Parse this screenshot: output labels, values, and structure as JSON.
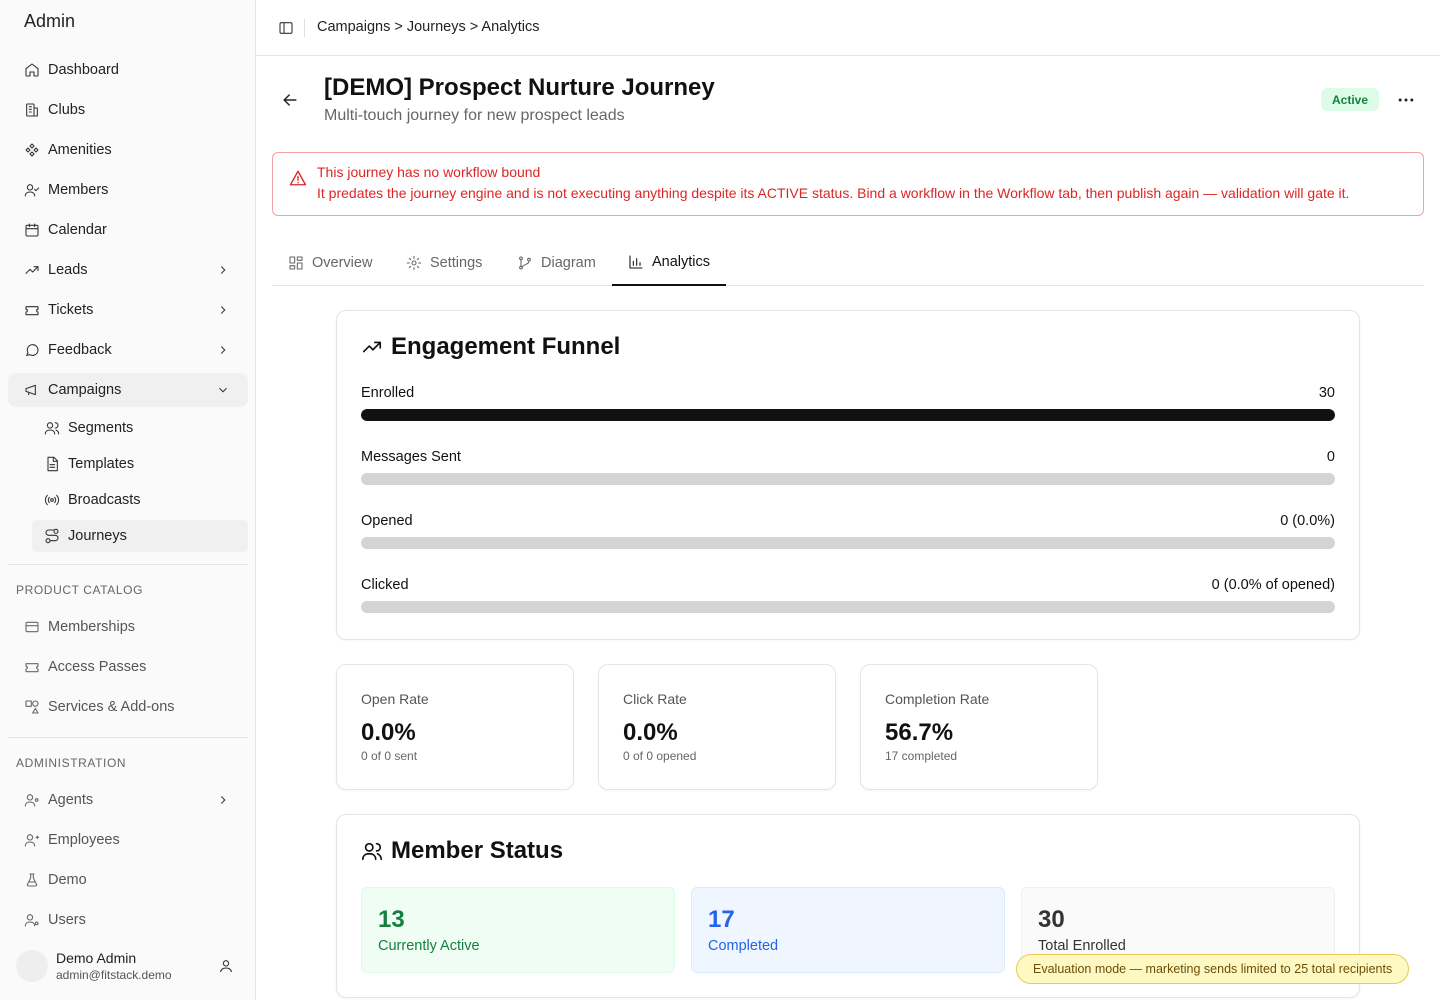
{
  "sidebar": {
    "brand": "Admin",
    "items": [
      {
        "label": "Dashboard"
      },
      {
        "label": "Clubs"
      },
      {
        "label": "Amenities"
      },
      {
        "label": "Members"
      },
      {
        "label": "Calendar"
      },
      {
        "label": "Leads"
      },
      {
        "label": "Tickets"
      },
      {
        "label": "Feedback"
      },
      {
        "label": "Campaigns"
      }
    ],
    "campaign_sub": [
      {
        "label": "Segments"
      },
      {
        "label": "Templates"
      },
      {
        "label": "Broadcasts"
      },
      {
        "label": "Journeys"
      }
    ],
    "product_catalog": {
      "heading": "PRODUCT CATALOG",
      "items": [
        {
          "label": "Memberships"
        },
        {
          "label": "Access Passes"
        },
        {
          "label": "Services & Add-ons"
        }
      ]
    },
    "administration": {
      "heading": "ADMINISTRATION",
      "items": [
        {
          "label": "Agents"
        },
        {
          "label": "Employees"
        },
        {
          "label": "Demo"
        },
        {
          "label": "Users"
        }
      ]
    },
    "user": {
      "name": "Demo Admin",
      "email": "admin@fitstack.demo"
    }
  },
  "topbar": {
    "breadcrumb": "Campaigns > Journeys > Analytics"
  },
  "header": {
    "title": "[DEMO] Prospect Nurture Journey",
    "subtitle": "Multi-touch journey for new prospect leads",
    "status": "Active"
  },
  "alert": {
    "title": "This journey has no workflow bound",
    "body": "It predates the journey engine and is not executing anything despite its ACTIVE status. Bind a workflow in the Workflow tab, then publish again — validation will gate it."
  },
  "tabs": [
    {
      "label": "Overview"
    },
    {
      "label": "Settings"
    },
    {
      "label": "Diagram"
    },
    {
      "label": "Analytics"
    }
  ],
  "funnel": {
    "title": "Engagement Funnel",
    "rows": [
      {
        "label": "Enrolled",
        "value": "30",
        "fraction": 1.0
      },
      {
        "label": "Messages Sent",
        "value": "0",
        "fraction": 0
      },
      {
        "label": "Opened",
        "value": "0 (0.0%)",
        "fraction": 0
      },
      {
        "label": "Clicked",
        "value": "0 (0.0% of opened)",
        "fraction": 0
      }
    ]
  },
  "stats": [
    {
      "label": "Open Rate",
      "value": "0.0%",
      "sub": "0 of 0 sent"
    },
    {
      "label": "Click Rate",
      "value": "0.0%",
      "sub": "0 of 0 opened"
    },
    {
      "label": "Completion Rate",
      "value": "56.7%",
      "sub": "17 completed"
    }
  ],
  "member_status": {
    "title": "Member Status",
    "boxes": [
      {
        "value": "13",
        "label": "Currently Active"
      },
      {
        "value": "17",
        "label": "Completed"
      },
      {
        "value": "30",
        "label": "Total Enrolled"
      }
    ]
  },
  "eval_banner": "Evaluation mode — marketing sends limited to 25 total recipients",
  "colors": {
    "accent_green": "#15803d",
    "accent_blue": "#2563eb",
    "danger": "#dc2626"
  }
}
